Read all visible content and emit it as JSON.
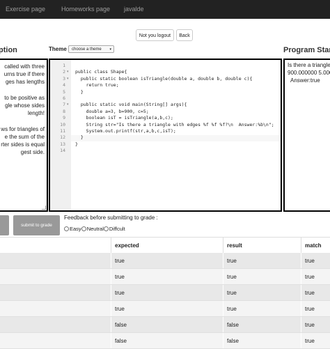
{
  "navbar": {
    "items": [
      "Exercise page",
      "Homeworks page",
      "javalde"
    ]
  },
  "buttons": {
    "not_you": "Not you logout",
    "back": "Back",
    "submit": "submit to grade"
  },
  "headings": {
    "description": "ption",
    "program_state": "Program Stan"
  },
  "theme": {
    "label": "Theme",
    "selected": "choose a theme"
  },
  "description_text": "called with three\nurns true if there\nges has lengths\n\nto be positive as\ngle whose sides\nlength!\n\nws for triangles of\ne the sum of the\nrter sides is equal\ngest side.",
  "editor": {
    "line_numbers": [
      "1",
      "2",
      "3",
      "4",
      "5",
      "6",
      "7",
      "8",
      "9",
      "10",
      "11",
      "12",
      "13",
      "14"
    ],
    "fold_markers": [
      "",
      "▾",
      "▾",
      "",
      "",
      "",
      "▾",
      "",
      "",
      "",
      "",
      "",
      "",
      ""
    ],
    "code_lines": [
      "",
      "public class Shape{",
      "  public static boolean isTriangle(double a, double b, double c){",
      "    return true;",
      "  }",
      "",
      "  public static void main(String[] args){",
      "    double a=3, b=900, c=5;",
      "    boolean isT = isTriangle(a,b,c);",
      "    String str=\"Is there a triangle with edges %f %f %f?\\n  Answer:%b\\n\";",
      "    System.out.printf(str,a,b,c,isT);",
      "  }",
      "}",
      ""
    ]
  },
  "output_text": "Is there a triangle\n900.000000 5.000\n  Answer:true",
  "feedback": {
    "label": "Feedback before submitting to grade :",
    "options": [
      "Easy",
      "Neutral",
      "Diffcult"
    ]
  },
  "results_table": {
    "headers": [
      "",
      "expected",
      "result",
      "match"
    ],
    "rows": [
      {
        "expected": "true",
        "result": "true",
        "match": "true"
      },
      {
        "expected": "true",
        "result": "true",
        "match": "true"
      },
      {
        "expected": "true",
        "result": "true",
        "match": "true"
      },
      {
        "expected": "true",
        "result": "true",
        "match": "true"
      },
      {
        "expected": "false",
        "result": "false",
        "match": "true"
      },
      {
        "expected": "false",
        "result": "false",
        "match": "true"
      }
    ]
  }
}
